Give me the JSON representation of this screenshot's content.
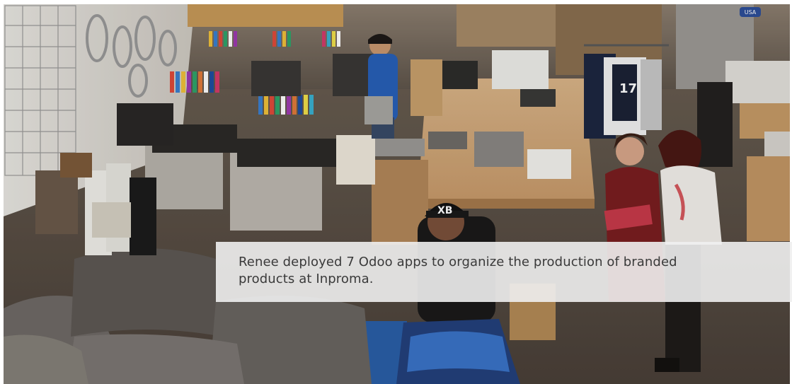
{
  "photo": {
    "subject": "workshop-photo",
    "cap_logo_text": "XB",
    "jersey_number": "17",
    "corner_sign_text": "USA"
  },
  "caption": {
    "text": "Renee deployed 7 Odoo apps to organize the production of branded products at Inproma."
  }
}
